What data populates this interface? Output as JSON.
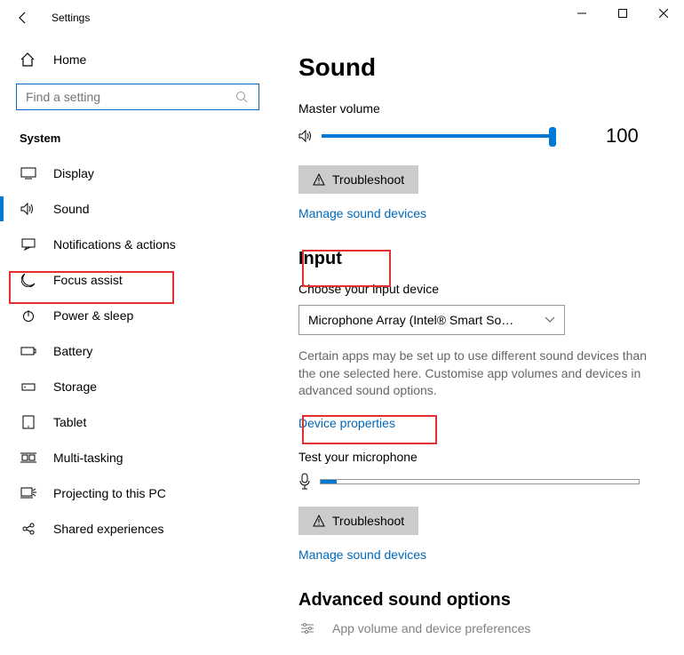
{
  "window": {
    "title": "Settings"
  },
  "sidebar": {
    "home": "Home",
    "search_placeholder": "Find a setting",
    "section": "System",
    "items": [
      {
        "label": "Display"
      },
      {
        "label": "Sound"
      },
      {
        "label": "Notifications & actions"
      },
      {
        "label": "Focus assist"
      },
      {
        "label": "Power & sleep"
      },
      {
        "label": "Battery"
      },
      {
        "label": "Storage"
      },
      {
        "label": "Tablet"
      },
      {
        "label": "Multi-tasking"
      },
      {
        "label": "Projecting to this PC"
      },
      {
        "label": "Shared experiences"
      }
    ]
  },
  "main": {
    "title": "Sound",
    "master_volume_label": "Master volume",
    "volume_value": "100",
    "troubleshoot": "Troubleshoot",
    "manage": "Manage sound devices",
    "input_heading": "Input",
    "choose_input": "Choose your input device",
    "input_device": "Microphone Array (Intel® Smart So…",
    "help_text": "Certain apps may be set up to use different sound devices than the one selected here. Customise app volumes and devices in advanced sound options.",
    "device_properties": "Device properties",
    "test_mic": "Test your microphone",
    "advanced_heading": "Advanced sound options",
    "app_volume_label": "App volume and device preferences"
  }
}
